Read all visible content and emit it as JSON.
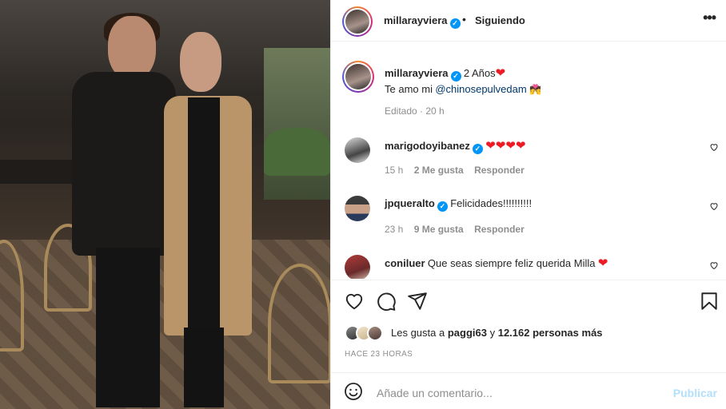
{
  "post": {
    "author": "millarayviera",
    "follow_status": "Siguiendo",
    "dot": "•",
    "more": "•••"
  },
  "caption": {
    "author": "millarayviera",
    "text_a": "2 Años",
    "heart": "❤",
    "text_b": "Te amo mi",
    "mention": "@chinosepulvedam",
    "emoji": "💏",
    "edited": "Editado",
    "age": "20 h"
  },
  "comments": [
    {
      "user": "marigodoyibanez",
      "text": "❤❤❤❤",
      "age": "15 h",
      "likes": "2 Me gusta",
      "reply": "Responder"
    },
    {
      "user": "jpqueralto",
      "text": "Felicidades!!!!!!!!!!",
      "age": "23 h",
      "likes": "9 Me gusta",
      "reply": "Responder"
    },
    {
      "user": "coniluer",
      "text": "Que seas siempre feliz querida Milla",
      "heart": "❤"
    }
  ],
  "likes": {
    "prefix": "Les gusta a",
    "first": "paggi63",
    "mid": "y",
    "count": "12.162 personas más"
  },
  "time_ago": "HACE 23 HORAS",
  "add_comment": {
    "placeholder": "Añade un comentario...",
    "post": "Publicar"
  },
  "icons": {
    "verified": "✓"
  },
  "colors": {
    "verified": "#0095f6",
    "link": "#00376b",
    "heart": "#ed1c24",
    "muted": "#8e8e8e",
    "post_disabled": "#b2dffc"
  }
}
